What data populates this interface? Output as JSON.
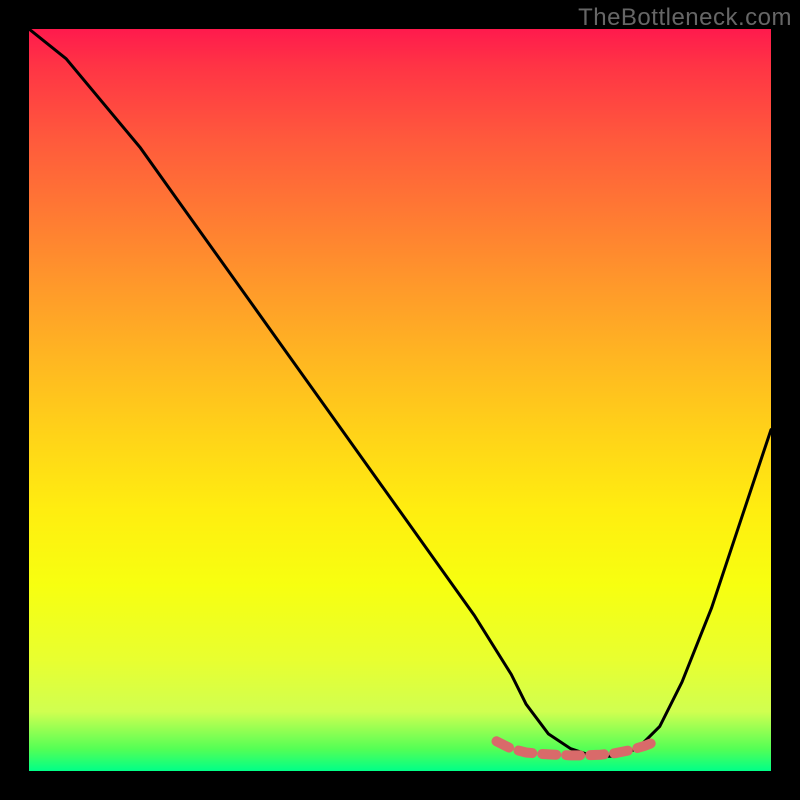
{
  "attribution": "TheBottleneck.com",
  "chart_data": {
    "type": "line",
    "title": "",
    "xlabel": "",
    "ylabel": "",
    "xlim": [
      0,
      100
    ],
    "ylim": [
      0,
      100
    ],
    "series": [
      {
        "name": "bottleneck-curve",
        "x": [
          0,
          5,
          10,
          15,
          20,
          25,
          30,
          35,
          40,
          45,
          50,
          55,
          60,
          65,
          67,
          70,
          73,
          76,
          79,
          82,
          85,
          88,
          92,
          96,
          100
        ],
        "y": [
          100,
          96,
          90,
          84,
          77,
          70,
          63,
          56,
          49,
          42,
          35,
          28,
          21,
          13,
          9,
          5,
          3,
          2,
          2,
          3,
          6,
          12,
          22,
          34,
          46
        ]
      },
      {
        "name": "highlighted-bottom",
        "x": [
          63,
          65,
          67,
          69,
          71,
          73,
          75,
          77,
          79,
          81,
          83,
          85
        ],
        "y": [
          4,
          3,
          2.5,
          2.3,
          2.2,
          2.1,
          2.1,
          2.2,
          2.4,
          2.8,
          3.4,
          4.2
        ]
      }
    ],
    "colors": {
      "curve": "#000000",
      "highlight": "#d96a6a",
      "background_gradient": [
        "#ff1a4d",
        "#ffee10",
        "#00ff88"
      ]
    }
  }
}
